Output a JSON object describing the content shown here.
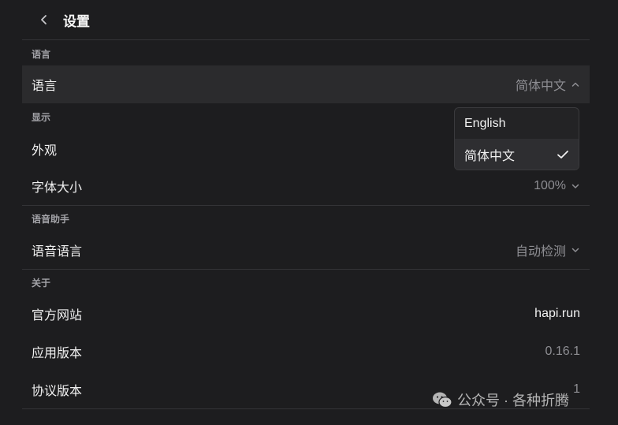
{
  "header": {
    "title": "设置",
    "back_icon": "chevron-left-icon"
  },
  "sections": {
    "language": {
      "label": "语言",
      "row_label": "语言",
      "row_value": "简体中文"
    },
    "display": {
      "label": "显示",
      "appearance_label": "外观",
      "font_size_label": "字体大小",
      "font_size_value": "100%"
    },
    "voice": {
      "label": "语音助手",
      "voice_language_label": "语音语言",
      "voice_language_value": "自动检测"
    },
    "about": {
      "label": "关于",
      "website_label": "官方网站",
      "website_value": "hapi.run",
      "app_version_label": "应用版本",
      "app_version_value": "0.16.1",
      "protocol_version_label": "协议版本",
      "protocol_version_value": "1"
    }
  },
  "language_dropdown": {
    "options": [
      "English",
      "简体中文"
    ],
    "selected": "简体中文",
    "check_icon": "checkmark-icon"
  },
  "watermark": {
    "text": "公众号 · 各种折腾"
  },
  "colors": {
    "background": "#1d1d1f",
    "highlight_row": "#2b2b2d",
    "muted_text": "#8e8e93",
    "divider": "#343437"
  }
}
